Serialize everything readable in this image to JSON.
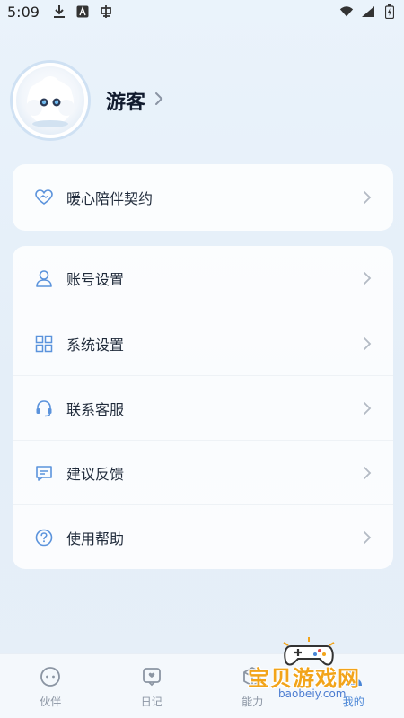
{
  "status_bar": {
    "time": "5:09"
  },
  "profile": {
    "name": "游客"
  },
  "contract_card": {
    "label": "暖心陪伴契约"
  },
  "menu": {
    "items": [
      {
        "label": "账号设置",
        "icon": "user-icon"
      },
      {
        "label": "系统设置",
        "icon": "grid-icon"
      },
      {
        "label": "联系客服",
        "icon": "headset-icon"
      },
      {
        "label": "建议反馈",
        "icon": "message-icon"
      },
      {
        "label": "使用帮助",
        "icon": "help-icon"
      }
    ]
  },
  "tabbar": {
    "tabs": [
      {
        "label": "伙伴",
        "icon": "chat-bubble-icon"
      },
      {
        "label": "日记",
        "icon": "diary-icon"
      },
      {
        "label": "能力",
        "icon": "cube-icon"
      },
      {
        "label": "我的",
        "icon": "profile-icon"
      }
    ],
    "active_index": 3
  },
  "watermark": {
    "title": "宝贝游戏网",
    "url": "baobeiy.com"
  },
  "colors": {
    "accent": "#4a86d6",
    "icon_blue": "#5b93dc",
    "watermark_orange": "#f2a41a"
  }
}
